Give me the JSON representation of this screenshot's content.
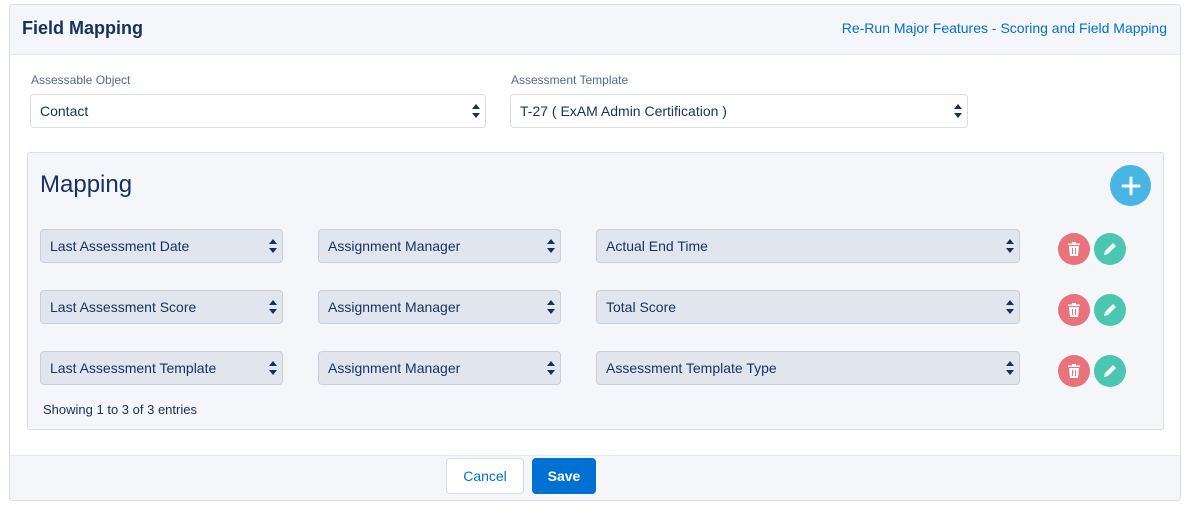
{
  "header": {
    "title": "Field Mapping",
    "link": "Re-Run Major Features - Scoring and Field Mapping"
  },
  "assessable_object": {
    "label": "Assessable Object",
    "value": "Contact"
  },
  "assessment_template": {
    "label": "Assessment Template",
    "value": "T-27 ( ExAM Admin Certification )"
  },
  "mapping": {
    "title": "Mapping",
    "rows": [
      {
        "field": "Last Assessment Date",
        "source": "Assignment Manager",
        "target": "Actual End Time"
      },
      {
        "field": "Last Assessment Score",
        "source": "Assignment Manager",
        "target": "Total Score"
      },
      {
        "field": "Last Assessment Template",
        "source": "Assignment Manager",
        "target": "Assessment Template Type"
      }
    ],
    "entries_prefix": "Showing ",
    "entries_from": "1",
    "entries_mid1": " to ",
    "entries_to": "3",
    "entries_mid2": " of ",
    "entries_total": "3",
    "entries_suffix": " entries"
  },
  "actions": {
    "cancel": "Cancel",
    "save": "Save"
  },
  "icons": {
    "add": "plus-icon",
    "delete": "trash-icon",
    "edit": "pencil-icon",
    "select_arrows": "up-down-arrows-icon"
  },
  "colors": {
    "brand": "#0070d2",
    "add": "#48b5e3",
    "delete": "#e8737a",
    "edit": "#4bc6b0"
  }
}
